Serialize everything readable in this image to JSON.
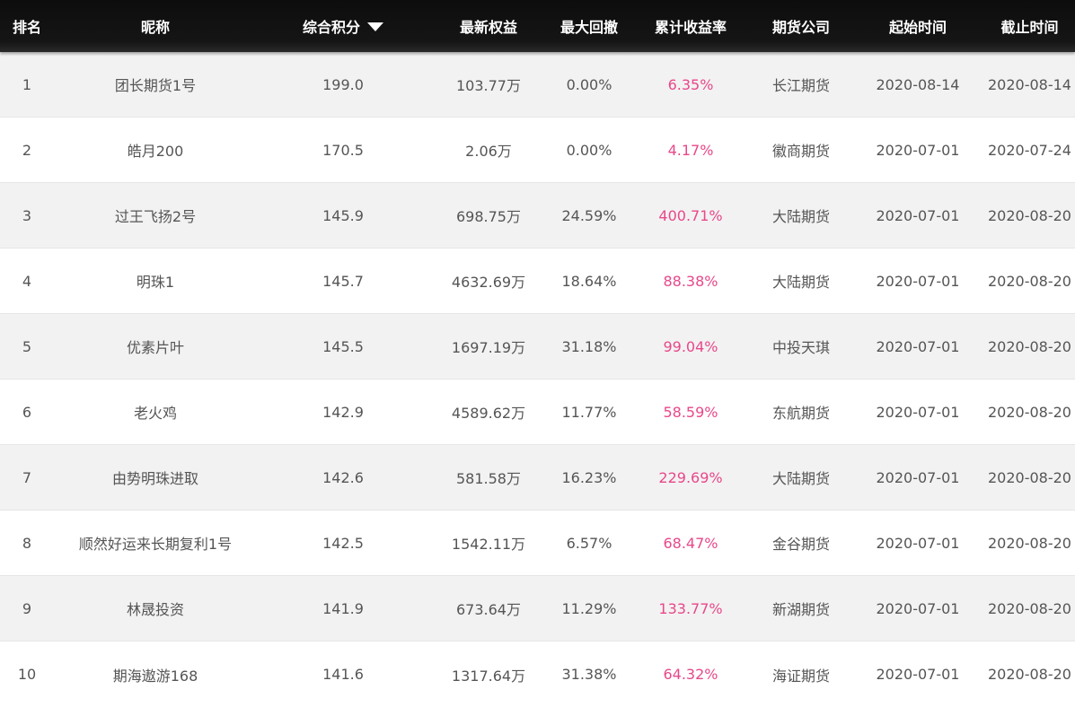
{
  "header": {
    "rank": "排名",
    "name": "昵称",
    "score": "综合积分",
    "equity": "最新权益",
    "drawdown": "最大回撤",
    "return": "累计收益率",
    "company": "期货公司",
    "start": "起始时间",
    "end": "截止时间",
    "sort_icon": "triangle-down-icon"
  },
  "colors": {
    "header_bg": "#111111",
    "row_alt": "#f2f2f2",
    "return_text": "#e8488a"
  },
  "rows": [
    {
      "rank": "1",
      "name": "团长期货1号",
      "score": "199.0",
      "equity": "103.77万",
      "drawdown": "0.00%",
      "return": "6.35%",
      "company": "长江期货",
      "start": "2020-08-14",
      "end": "2020-08-14"
    },
    {
      "rank": "2",
      "name": "皓月200",
      "score": "170.5",
      "equity": "2.06万",
      "drawdown": "0.00%",
      "return": "4.17%",
      "company": "徽商期货",
      "start": "2020-07-01",
      "end": "2020-07-24"
    },
    {
      "rank": "3",
      "name": "过王飞扬2号",
      "score": "145.9",
      "equity": "698.75万",
      "drawdown": "24.59%",
      "return": "400.71%",
      "company": "大陆期货",
      "start": "2020-07-01",
      "end": "2020-08-20"
    },
    {
      "rank": "4",
      "name": "明珠1",
      "score": "145.7",
      "equity": "4632.69万",
      "drawdown": "18.64%",
      "return": "88.38%",
      "company": "大陆期货",
      "start": "2020-07-01",
      "end": "2020-08-20"
    },
    {
      "rank": "5",
      "name": "优素片叶",
      "score": "145.5",
      "equity": "1697.19万",
      "drawdown": "31.18%",
      "return": "99.04%",
      "company": "中投天琪",
      "start": "2020-07-01",
      "end": "2020-08-20"
    },
    {
      "rank": "6",
      "name": "老火鸡",
      "score": "142.9",
      "equity": "4589.62万",
      "drawdown": "11.77%",
      "return": "58.59%",
      "company": "东航期货",
      "start": "2020-07-01",
      "end": "2020-08-20"
    },
    {
      "rank": "7",
      "name": "由势明珠进取",
      "score": "142.6",
      "equity": "581.58万",
      "drawdown": "16.23%",
      "return": "229.69%",
      "company": "大陆期货",
      "start": "2020-07-01",
      "end": "2020-08-20"
    },
    {
      "rank": "8",
      "name": "顺然好运来长期复利1号",
      "score": "142.5",
      "equity": "1542.11万",
      "drawdown": "6.57%",
      "return": "68.47%",
      "company": "金谷期货",
      "start": "2020-07-01",
      "end": "2020-08-20"
    },
    {
      "rank": "9",
      "name": "林晟投资",
      "score": "141.9",
      "equity": "673.64万",
      "drawdown": "11.29%",
      "return": "133.77%",
      "company": "新湖期货",
      "start": "2020-07-01",
      "end": "2020-08-20"
    },
    {
      "rank": "10",
      "name": "期海遨游168",
      "score": "141.6",
      "equity": "1317.64万",
      "drawdown": "31.38%",
      "return": "64.32%",
      "company": "海证期货",
      "start": "2020-07-01",
      "end": "2020-08-20"
    }
  ]
}
